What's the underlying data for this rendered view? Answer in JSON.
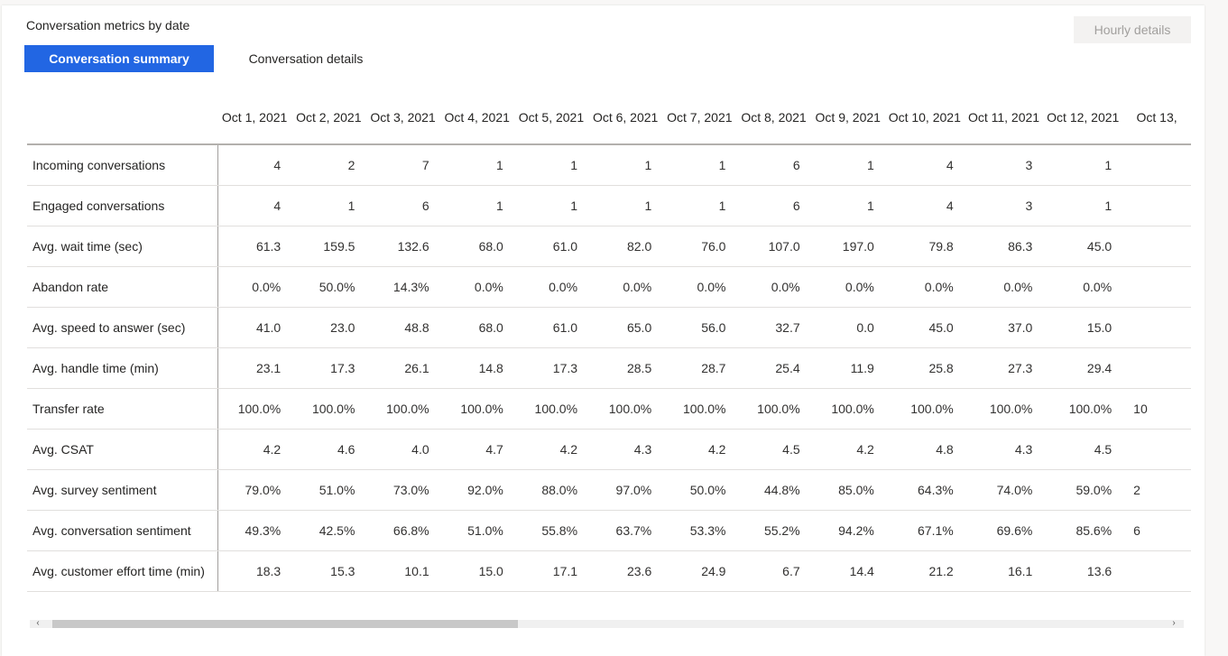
{
  "header": {
    "title": "Conversation metrics by date",
    "hourly_button": "Hourly details"
  },
  "tabs": [
    {
      "label": "Conversation summary",
      "active": true
    },
    {
      "label": "Conversation details",
      "active": false
    }
  ],
  "colors": {
    "accent": "#2266e3",
    "disabled_bg": "#f3f2f1",
    "disabled_text": "#a19f9d"
  },
  "table": {
    "columns": [
      "Oct 1, 2021",
      "Oct 2, 2021",
      "Oct 3, 2021",
      "Oct 4, 2021",
      "Oct 5, 2021",
      "Oct 6, 2021",
      "Oct 7, 2021",
      "Oct 8, 2021",
      "Oct 9, 2021",
      "Oct 10, 2021",
      "Oct 11, 2021",
      "Oct 12, 2021",
      "Oct 13,"
    ],
    "rows": [
      {
        "label": "Incoming conversations",
        "values": [
          "4",
          "2",
          "7",
          "1",
          "1",
          "1",
          "1",
          "6",
          "1",
          "4",
          "3",
          "1",
          ""
        ]
      },
      {
        "label": "Engaged conversations",
        "values": [
          "4",
          "1",
          "6",
          "1",
          "1",
          "1",
          "1",
          "6",
          "1",
          "4",
          "3",
          "1",
          ""
        ]
      },
      {
        "label": "Avg. wait time (sec)",
        "values": [
          "61.3",
          "159.5",
          "132.6",
          "68.0",
          "61.0",
          "82.0",
          "76.0",
          "107.0",
          "197.0",
          "79.8",
          "86.3",
          "45.0",
          ""
        ]
      },
      {
        "label": "Abandon rate",
        "values": [
          "0.0%",
          "50.0%",
          "14.3%",
          "0.0%",
          "0.0%",
          "0.0%",
          "0.0%",
          "0.0%",
          "0.0%",
          "0.0%",
          "0.0%",
          "0.0%",
          ""
        ]
      },
      {
        "label": "Avg. speed to answer (sec)",
        "values": [
          "41.0",
          "23.0",
          "48.8",
          "68.0",
          "61.0",
          "65.0",
          "56.0",
          "32.7",
          "0.0",
          "45.0",
          "37.0",
          "15.0",
          ""
        ]
      },
      {
        "label": "Avg. handle time (min)",
        "values": [
          "23.1",
          "17.3",
          "26.1",
          "14.8",
          "17.3",
          "28.5",
          "28.7",
          "25.4",
          "11.9",
          "25.8",
          "27.3",
          "29.4",
          ""
        ]
      },
      {
        "label": "Transfer rate",
        "values": [
          "100.0%",
          "100.0%",
          "100.0%",
          "100.0%",
          "100.0%",
          "100.0%",
          "100.0%",
          "100.0%",
          "100.0%",
          "100.0%",
          "100.0%",
          "100.0%",
          "10"
        ]
      },
      {
        "label": "Avg. CSAT",
        "values": [
          "4.2",
          "4.6",
          "4.0",
          "4.7",
          "4.2",
          "4.3",
          "4.2",
          "4.5",
          "4.2",
          "4.8",
          "4.3",
          "4.5",
          ""
        ]
      },
      {
        "label": "Avg. survey sentiment",
        "values": [
          "79.0%",
          "51.0%",
          "73.0%",
          "92.0%",
          "88.0%",
          "97.0%",
          "50.0%",
          "44.8%",
          "85.0%",
          "64.3%",
          "74.0%",
          "59.0%",
          "2"
        ]
      },
      {
        "label": "Avg. conversation sentiment",
        "values": [
          "49.3%",
          "42.5%",
          "66.8%",
          "51.0%",
          "55.8%",
          "63.7%",
          "53.3%",
          "55.2%",
          "94.2%",
          "67.1%",
          "69.6%",
          "85.6%",
          "6"
        ]
      },
      {
        "label": "Avg. customer effort time (min)",
        "values": [
          "18.3",
          "15.3",
          "10.1",
          "15.0",
          "17.1",
          "23.6",
          "24.9",
          "6.7",
          "14.4",
          "21.2",
          "16.1",
          "13.6",
          ""
        ]
      }
    ]
  },
  "scrollbar": {
    "left_arrow": "‹",
    "right_arrow": "›",
    "position_fraction": 0.0,
    "visible_fraction": 0.42
  }
}
